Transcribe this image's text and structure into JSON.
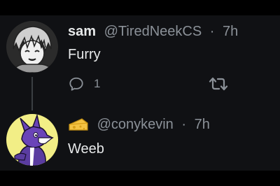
{
  "tweets": [
    {
      "display_name": "sam",
      "handle": "@TiredNeekCS",
      "separator": "·",
      "time": "7h",
      "text": "Furry",
      "reply_count": "1",
      "avatar_icon": "anime-boy-avatar"
    },
    {
      "display_name_emoji": "cheese-icon",
      "handle": "@conykevin",
      "separator": "·",
      "time": "7h",
      "text": "Weeb",
      "avatar_icon": "purple-furry-avatar"
    }
  ],
  "colors": {
    "background": "#101114",
    "text": "#e7e9ea",
    "muted": "#8b9198",
    "thread_line": "#3b3f43"
  }
}
